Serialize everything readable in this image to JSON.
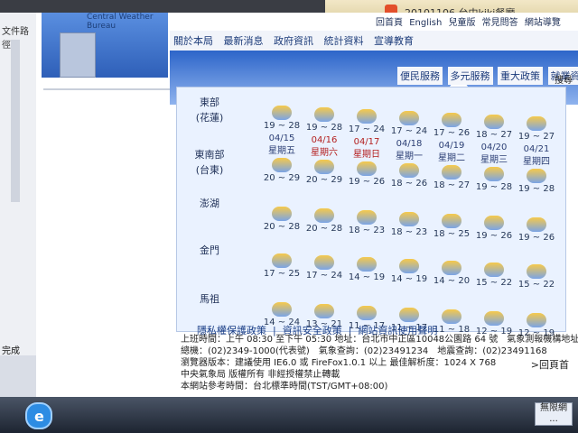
{
  "browser": {
    "tab_title": "20101106 台中kiki餐廳 ...",
    "left_label": "文件路徑",
    "tabbar_small": ""
  },
  "header": {
    "bureau_name": "Central Weather Bureau"
  },
  "top_links": [
    "回首頁",
    "English",
    "兒童版",
    "常見問答",
    "網站導覽"
  ],
  "nav": {
    "items": [
      "關於本局",
      "最新消息",
      "政府資訊",
      "統計資料",
      "宣導教育",
      "便民服務",
      "多元服務",
      "重大政策",
      "就業資訊"
    ],
    "search_label": "搜尋"
  },
  "forecast": {
    "stations": [
      {
        "name_line1": "東部",
        "name_line2": "(花蓮)"
      },
      {
        "name_line1": "東南部",
        "name_line2": "(台東)"
      },
      {
        "name_line1": "澎湖",
        "name_line2": ""
      },
      {
        "name_line1": "金門",
        "name_line2": ""
      },
      {
        "name_line1": "馬祖",
        "name_line2": ""
      }
    ],
    "dates": [
      {
        "date": "04/15",
        "weekday": "星期五",
        "highlight": false
      },
      {
        "date": "04/16",
        "weekday": "星期六",
        "highlight": true
      },
      {
        "date": "04/17",
        "weekday": "星期日",
        "highlight": true
      },
      {
        "date": "04/18",
        "weekday": "星期一",
        "highlight": false
      },
      {
        "date": "04/19",
        "weekday": "星期二",
        "highlight": false
      },
      {
        "date": "04/20",
        "weekday": "星期三",
        "highlight": false
      },
      {
        "date": "04/21",
        "weekday": "星期四",
        "highlight": false
      }
    ],
    "rows": [
      {
        "temps": [
          "19 ~ 28",
          "19 ~ 28",
          "17 ~ 24",
          "17 ~ 24",
          "17 ~ 26",
          "18 ~ 27",
          "19 ~ 27"
        ]
      },
      {
        "temps": [
          "20 ~ 29",
          "20 ~ 29",
          "19 ~ 26",
          "18 ~ 26",
          "18 ~ 27",
          "19 ~ 28",
          "19 ~ 28"
        ]
      },
      {
        "temps": [
          "20 ~ 28",
          "20 ~ 28",
          "18 ~ 23",
          "18 ~ 23",
          "18 ~ 25",
          "19 ~ 26",
          "19 ~ 26"
        ]
      },
      {
        "temps": [
          "17 ~ 25",
          "17 ~ 24",
          "14 ~ 19",
          "14 ~ 19",
          "14 ~ 20",
          "15 ~ 22",
          "15 ~ 22"
        ]
      },
      {
        "temps": [
          "14 ~ 24",
          "13 ~ 21",
          "11 ~ 17",
          "11 ~ 17",
          "11 ~ 18",
          "12 ~ 19",
          "12 ~ 19"
        ]
      }
    ]
  },
  "footer": {
    "links": [
      "隱私權保護政策",
      "資訊安全政策",
      "網站資訊使用聲明"
    ],
    "line1": "上班時間：上午 08:30 至下午 05:30 地址：台北市中正區10048公園路 64 號　氣象測報機構地址",
    "line2": "總機：(02)2349-1000(代表號)　氣象查詢：(02)23491234　地震查詢：(02)23491168",
    "line3": "瀏覽器版本：建議使用 IE6.0 或 FireFox1.0.1 以上 最佳解析度：1024 X 768",
    "line4": "中央氣象局 版權所有 非經授權禁止轉載",
    "line5": "本網站參考時間：台北標準時間(TST/GMT+08:00)",
    "back_to_top": ">回頁首"
  },
  "status": {
    "left": "完成"
  },
  "taskbar": {
    "right_label_1": "無限網",
    "right_label_2": "..."
  }
}
